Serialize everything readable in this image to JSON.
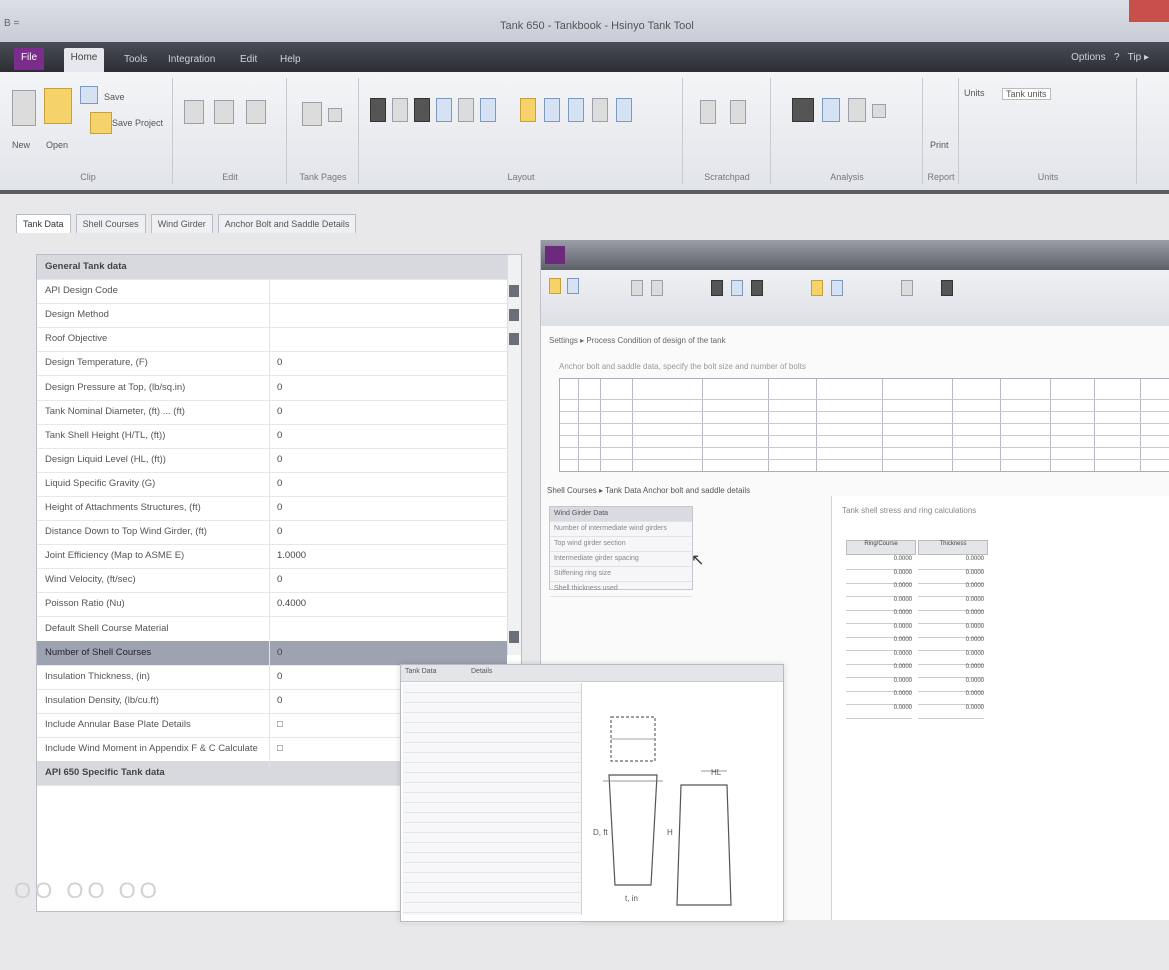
{
  "window": {
    "title": "Tank 650 - Tankbook - Hsinyo Tank Tool",
    "app_glyph": "B ="
  },
  "ribbon_tabs": [
    "File",
    "Home",
    "Tools",
    "Integration",
    "Edit",
    "Help"
  ],
  "ribbon_right": [
    "Options",
    "?",
    "Tip ▸"
  ],
  "ribbon": {
    "groups": [
      {
        "name": "Clip",
        "buttons": [
          "New",
          "Open",
          "Save",
          "Save Project"
        ]
      },
      {
        "name": "Edit"
      },
      {
        "name": "Tank Pages"
      },
      {
        "name": "Layout"
      },
      {
        "name": "Scratchpad"
      },
      {
        "name": "Analysis"
      },
      {
        "name": "Report",
        "button": "Print"
      },
      {
        "name": "Units",
        "field_label": "Units",
        "field_value": "Tank units"
      }
    ]
  },
  "form_tabs": [
    "Tank Data",
    "Shell Courses",
    "Wind Girder",
    "Anchor Bolt and Saddle Details"
  ],
  "property_grid": {
    "rows": [
      {
        "label": "General Tank data",
        "value": "",
        "type": "header"
      },
      {
        "label": "API Design Code",
        "value": ""
      },
      {
        "label": "Design Method",
        "value": ""
      },
      {
        "label": "Roof Objective",
        "value": ""
      },
      {
        "label": "Design Temperature, (F)",
        "value": "0"
      },
      {
        "label": "Design Pressure at Top, (lb/sq.in)",
        "value": "0"
      },
      {
        "label": "Tank Nominal Diameter, (ft) ... (ft)",
        "value": "0"
      },
      {
        "label": "Tank Shell Height (H/TL, (ft))",
        "value": "0"
      },
      {
        "label": "Design Liquid Level (HL, (ft))",
        "value": "0"
      },
      {
        "label": "Liquid Specific Gravity (G)",
        "value": "0"
      },
      {
        "label": "Height of Attachments Structures, (ft)",
        "value": "0"
      },
      {
        "label": "Distance Down to Top Wind Girder, (ft)",
        "value": "0"
      },
      {
        "label": "Joint Efficiency (Map to ASME E)",
        "value": "1.0000"
      },
      {
        "label": "Wind Velocity, (ft/sec)",
        "value": "0"
      },
      {
        "label": "Poisson Ratio (Nu)",
        "value": "0.4000"
      },
      {
        "label": "Default Shell Course Material",
        "value": ""
      },
      {
        "label": "Number of Shell Courses",
        "value": "0",
        "type": "selected"
      },
      {
        "label": "Insulation Thickness, (in)",
        "value": "0"
      },
      {
        "label": "Insulation Density, (lb/cu.ft)",
        "value": "0"
      },
      {
        "label": "Include Annular Base Plate Details",
        "value": "□"
      },
      {
        "label": "Include Wind Moment in Appendix F & C Calculate",
        "value": "□"
      },
      {
        "label": "API 650 Specific Tank data",
        "value": "",
        "type": "footer"
      }
    ]
  },
  "inner_window": {
    "subtitle": "Settings  ▸ Process  Condition of design of the tank",
    "description": "Anchor bolt and saddle data, specify the bolt size and number of bolts",
    "tabs": "Shell Courses  ▸ Tank Data  Anchor bolt and saddle details",
    "left_rows": [
      "Wind Girder Data",
      "Number of intermediate wind girders",
      "Top wind girder section",
      "Intermediate girder spacing",
      "Stiffening ring size",
      "Shell thickness used"
    ],
    "right_note": "Tank shell stress and ring calculations",
    "table_headers": [
      "Ring/Course",
      "Thickness"
    ],
    "table_values": [
      "0.0000",
      "0.0000",
      "0.0000",
      "0.0000",
      "0.0000",
      "0.0000",
      "0.0000",
      "0.0000",
      "0.0000",
      "0.0000",
      "0.0000",
      "0.0000"
    ]
  },
  "drawing_window": {
    "tabs": [
      "Tank Data",
      "Details"
    ],
    "dims": [
      "D, ft",
      "H",
      "HL",
      "t, in"
    ]
  },
  "watermark": "OO OO OO"
}
